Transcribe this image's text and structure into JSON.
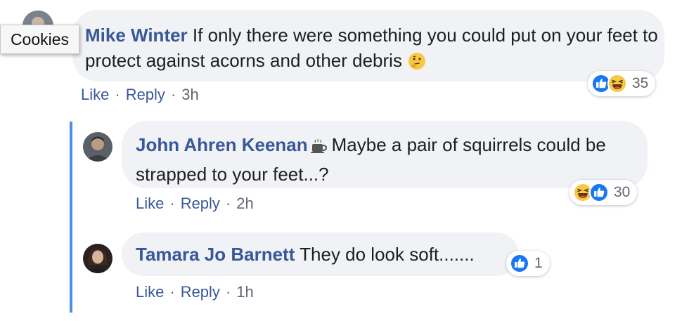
{
  "tooltip": {
    "text": "Cookies"
  },
  "comments": [
    {
      "author": "Mike Winter",
      "text": "If only there were something you could put on your feet to protect against acorns and other debris",
      "trailing_emoji": "thinking-emoji-icon",
      "actions": {
        "like": "Like",
        "separator": "·",
        "reply": "Reply",
        "time": "3h"
      },
      "reactions": {
        "icons": [
          "like-reaction-icon",
          "haha-reaction-icon"
        ],
        "count": "35"
      }
    },
    {
      "author": "John Ahren Keenan",
      "author_badge": "coffee-cup-icon",
      "text": "Maybe a pair of squirrels could be strapped to your feet...?",
      "actions": {
        "like": "Like",
        "separator": "·",
        "reply": "Reply",
        "time": "2h"
      },
      "reactions": {
        "icons": [
          "haha-reaction-icon",
          "like-reaction-icon"
        ],
        "count": "30"
      }
    },
    {
      "author": "Tamara Jo Barnett",
      "text": "They do look soft.......",
      "actions": {
        "like": "Like",
        "separator": "·",
        "reply": "Reply",
        "time": "1h"
      },
      "reactions": {
        "icons": [
          "like-reaction-icon"
        ],
        "count": "1"
      }
    }
  ],
  "colors": {
    "name": "#385898",
    "bubble": "#f0f2f5",
    "thread_line": "#4c8ee8",
    "like_blue": "#1877f2",
    "haha_yellow": "#f7c843"
  }
}
